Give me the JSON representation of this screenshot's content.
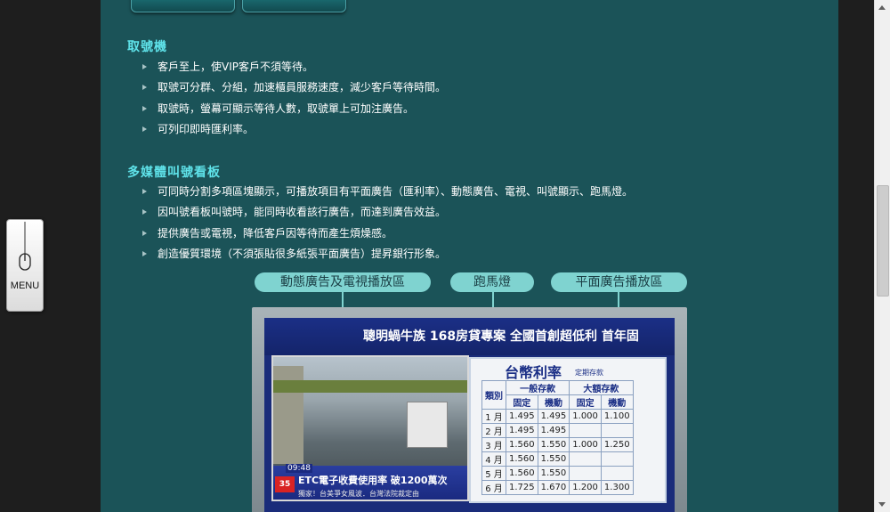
{
  "sections": [
    {
      "title": "取號機",
      "items": [
        "客戶至上，使VIP客戶不須等待。",
        "取號可分群、分組，加速櫃員服務速度，減少客戶等待時間。",
        "取號時，螢幕可顯示等待人數，取號單上可加注廣告。",
        "可列印即時匯利率。"
      ]
    },
    {
      "title": "多媒體叫號看板",
      "items": [
        "可同時分割多項區塊顯示，可播放項目有平面廣告（匯利率）、動態廣告、電視、叫號顯示、跑馬燈。",
        "因叫號看板叫號時，能同時收看該行廣告，而達到廣告效益。",
        "提供廣告或電視，降低客戶因等待而產生煩燥感。",
        "創造優質環境（不須張貼很多紙張平面廣告）提昇銀行形象。"
      ]
    }
  ],
  "diagram_labels": {
    "video_area": "動態廣告及電視播放區",
    "marquee": "跑馬燈",
    "print_ad": "平面廣告播放區"
  },
  "screen": {
    "marquee_text": "聰明蝸牛族 168房貸專案 全國首創超低利 首年固",
    "video_time": "09:48",
    "video_channel": "35",
    "video_headline": "ETC電子收費使用率 破1200萬次",
    "video_subline": "獨家！台美爭女風波．台灣法院裁定由",
    "rate_title": "台幣利率",
    "rate_note": "定期存款",
    "rate_headers": [
      "類別",
      "一般存款",
      "大額存款"
    ],
    "rate_subheaders": [
      "固定",
      "機動",
      "固定",
      "機動"
    ],
    "rate_rows": [
      [
        "1 月",
        "1.495",
        "1.495",
        "1.000",
        "1.100"
      ],
      [
        "2 月",
        "1.495",
        "1.495",
        "",
        ""
      ],
      [
        "3 月",
        "1.560",
        "1.550",
        "1.000",
        "1.250"
      ],
      [
        "4 月",
        "1.560",
        "1.550",
        "",
        ""
      ],
      [
        "5 月",
        "1.560",
        "1.550",
        "",
        ""
      ],
      [
        "6 月",
        "1.725",
        "1.670",
        "1.200",
        "1.300"
      ]
    ]
  },
  "menu": {
    "label": "MENU",
    "icon": "mouse-icon"
  },
  "colors": {
    "page_bg": "#1b5358",
    "title": "#5fe3ea",
    "pill": "#7fd3d0",
    "screen_blue": "#1a2c7a"
  }
}
